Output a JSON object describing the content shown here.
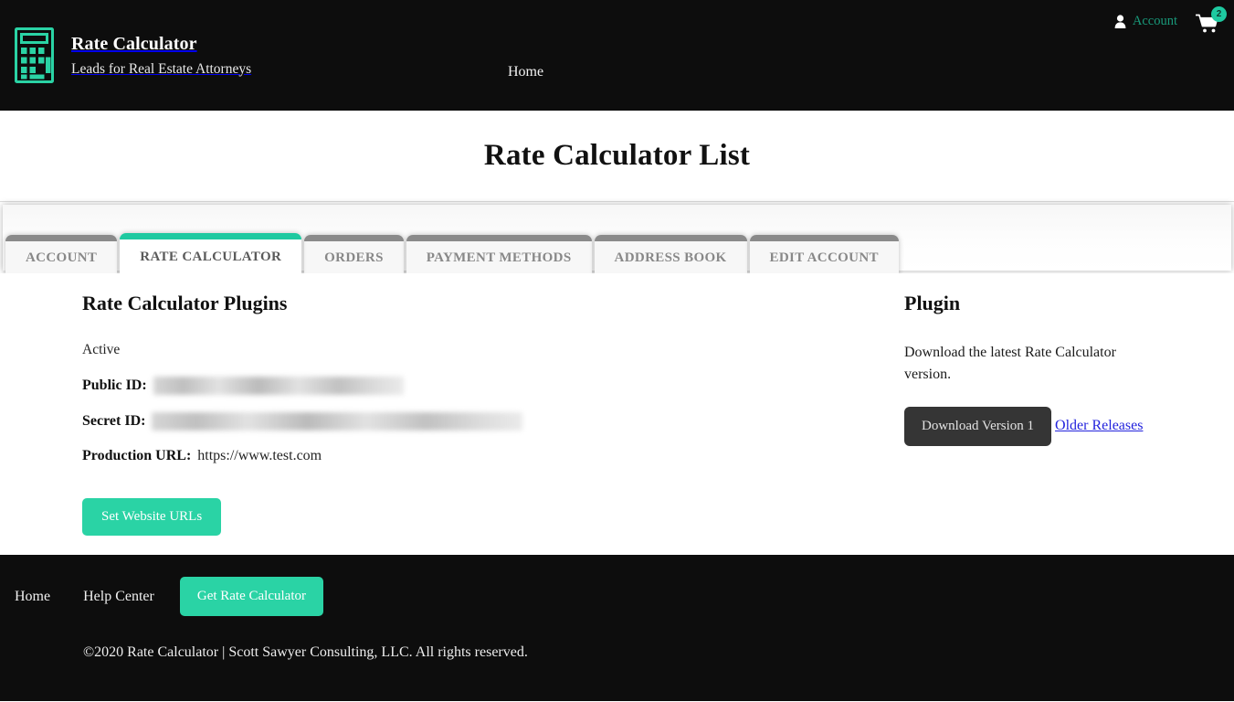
{
  "header": {
    "brand_title": "Rate Calculator",
    "brand_tagline": "Leads for Real Estate Attorneys",
    "logo_icon": "calculator-icon",
    "nav": [
      {
        "label": "Home"
      }
    ],
    "account": {
      "label": "Account",
      "icon": "person-icon"
    },
    "cart": {
      "icon": "shopping-cart-icon",
      "badge_count": "2"
    },
    "colors": {
      "background": "#0d0d0d",
      "accent_teal": "#1ec9a0",
      "account_text": "#19997a"
    }
  },
  "page": {
    "title": "Rate Calculator List"
  },
  "tabs": [
    {
      "label": "ACCOUNT",
      "active": false
    },
    {
      "label": "RATE CALCULATOR",
      "active": true
    },
    {
      "label": "ORDERS",
      "active": false
    },
    {
      "label": "PAYMENT METHODS",
      "active": false
    },
    {
      "label": "ADDRESS BOOK",
      "active": false
    },
    {
      "label": "EDIT ACCOUNT",
      "active": false
    }
  ],
  "main": {
    "section_title": "Rate Calculator Plugins",
    "status": "Active",
    "fields": [
      {
        "label": "Public ID:",
        "value": "",
        "redacted": true
      },
      {
        "label": "Secret ID:",
        "value": "",
        "redacted": true
      },
      {
        "label": "Production URL:",
        "value": "https://www.test.com",
        "redacted": false
      }
    ],
    "set_urls_button": "Set Website URLs"
  },
  "sidebar": {
    "title": "Plugin",
    "description": "Download the latest Rate Calculator version.",
    "download_button": "Download Version 1",
    "older_releases_link": "Older Releases"
  },
  "footer": {
    "links": [
      {
        "label": "Home"
      },
      {
        "label": "Help Center"
      }
    ],
    "cta_button": "Get Rate Calculator",
    "copyright": "©2020 Rate Calculator | Scott Sawyer Consulting, LLC. All rights reserved."
  },
  "theme": {
    "teal": "#2ad3a5",
    "dark": "#0d0d0d",
    "link_blue": "#2323dd"
  }
}
